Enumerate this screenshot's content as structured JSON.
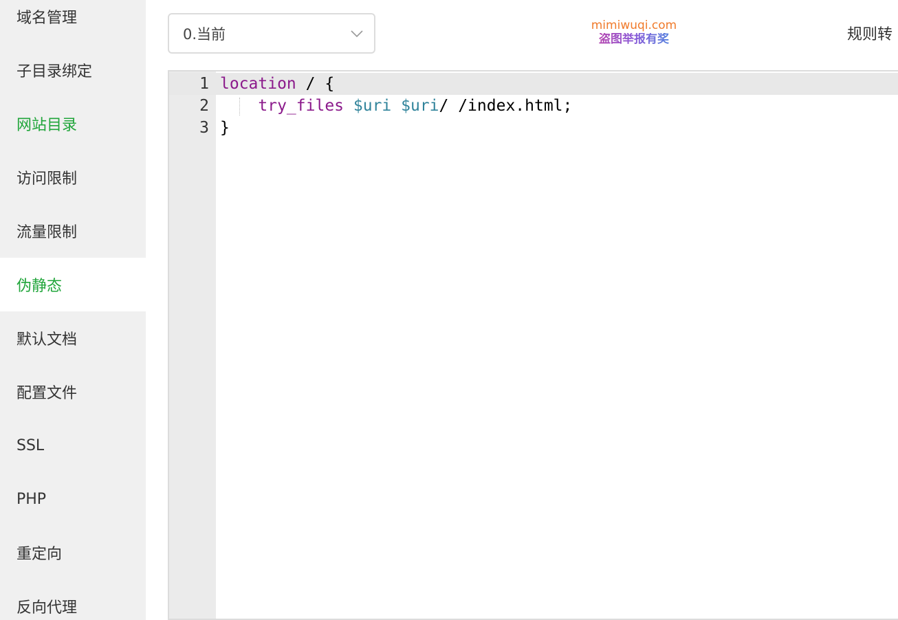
{
  "sidebar": {
    "items": [
      {
        "label": "域名管理"
      },
      {
        "label": "子目录绑定"
      },
      {
        "label": "网站目录"
      },
      {
        "label": "访问限制"
      },
      {
        "label": "流量限制"
      },
      {
        "label": "伪静态"
      },
      {
        "label": "默认文档"
      },
      {
        "label": "配置文件"
      },
      {
        "label": "SSL"
      },
      {
        "label": "PHP"
      },
      {
        "label": "重定向"
      },
      {
        "label": "反向代理"
      }
    ],
    "active": "伪静态",
    "highlighted": "网站目录",
    "accent_color": "#20a53a"
  },
  "toolbar": {
    "select_value": "0.当前",
    "select_icon": "chevron-down-icon",
    "rule_label": "规则转"
  },
  "watermark": {
    "line1": "mimiwuqi.com",
    "line2": "盗图举报有奖"
  },
  "editor": {
    "line_numbers": [
      "1",
      "2",
      "3"
    ],
    "line1": {
      "kw": "location",
      "rest": " / {"
    },
    "line2": {
      "indent": "    ",
      "kw": "try_files",
      "sp1": " ",
      "var1": "$uri",
      "sp2": " ",
      "var2": "$uri",
      "rest": "/ /index.html;"
    },
    "line3": {
      "text": "}"
    }
  }
}
